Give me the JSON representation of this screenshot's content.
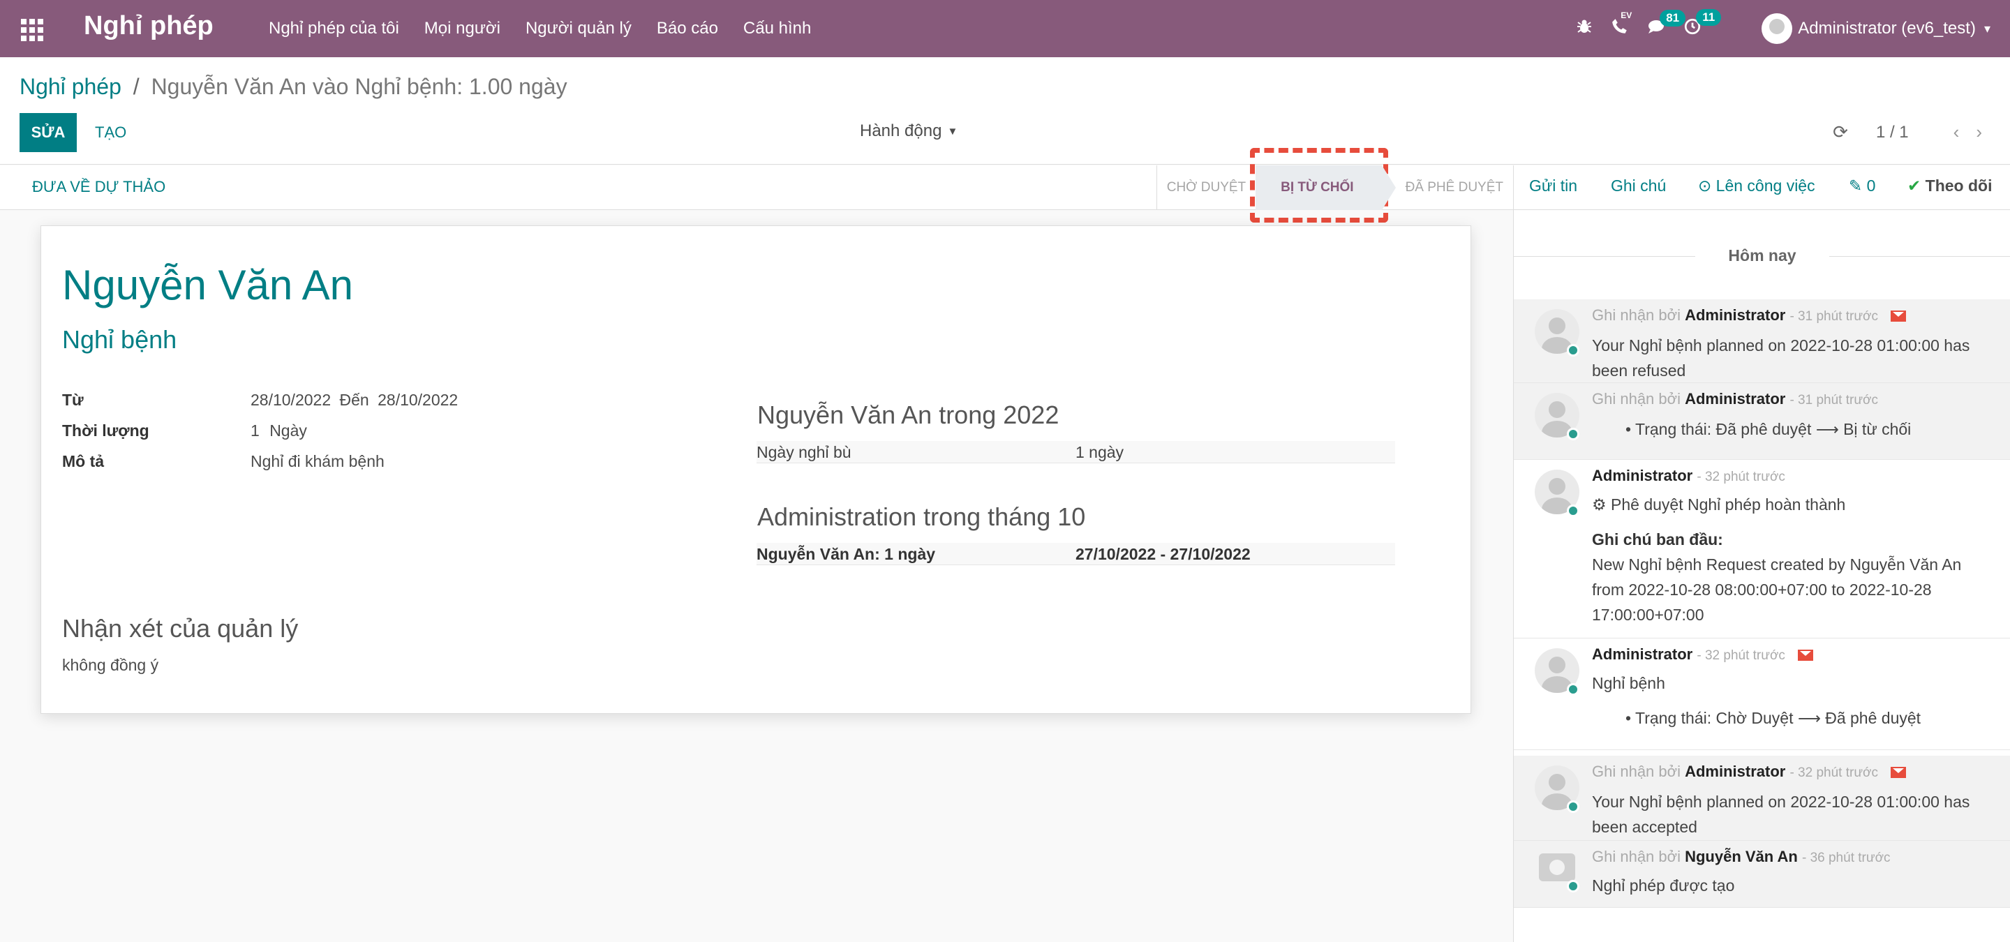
{
  "navbar": {
    "brand": "Nghỉ phép",
    "menu": [
      "Nghỉ phép của tôi",
      "Mọi người",
      "Người quản lý",
      "Báo cáo",
      "Cấu hình"
    ],
    "ev_label": "EV",
    "messages_count": "81",
    "activities_count": "11",
    "user": "Administrator (ev6_test)",
    "accent_color": "#875a7b"
  },
  "breadcrumb": {
    "parent": "Nghỉ phép",
    "separator": "/",
    "current": "Nguyễn Văn An vào Nghỉ bệnh: 1.00 ngày"
  },
  "buttons": {
    "edit": "SỬA",
    "create": "TẠO",
    "action": "Hành động"
  },
  "pager": {
    "value": "1 / 1"
  },
  "statusbar": {
    "reset": "ĐƯA VỀ DỰ THẢO",
    "stages": [
      "CHỜ DUYỆT",
      "BỊ TỪ CHỐI",
      "ĐÃ PHÊ DUYỆT"
    ],
    "active_stage": "BỊ TỪ CHỐI"
  },
  "form": {
    "employee": "Nguyễn Văn An",
    "leave_type": "Nghỉ bệnh",
    "from_label": "Từ",
    "from_date": "28/10/2022",
    "to_label": "Đến",
    "to_date": "28/10/2022",
    "duration_label": "Thời lượng",
    "duration_value": "1",
    "duration_unit": "Ngày",
    "desc_label": "Mô tả",
    "desc_value": "Nghỉ đi khám bệnh",
    "summary_title": "Nguyễn Văn An trong 2022",
    "summary_row_label": "Ngày nghỉ bù",
    "summary_row_value": "1 ngày",
    "month_title": "Administration trong tháng 10",
    "month_row_label": "Nguyễn Văn An: 1 ngày",
    "month_row_value": "27/10/2022 - 27/10/2022",
    "manager_title": "Nhận xét của quản lý",
    "manager_comment": "không đồng ý"
  },
  "chatter": {
    "send": "Gửi tin",
    "note": "Ghi chú",
    "activity": "Lên công việc",
    "attachments": "0",
    "follow": "Theo dõi",
    "today": "Hôm nay",
    "messages": [
      {
        "prefix": "Ghi nhận bởi",
        "author": "Administrator",
        "ago": "- 31 phút trước",
        "lines": [
          "Your Nghỉ bệnh planned on 2022-10-28 01:00:00 has",
          "been refused"
        ]
      },
      {
        "prefix": "Ghi nhận bởi",
        "author": "Administrator",
        "ago": "- 31 phút trước",
        "lines": [
          "•  Trạng thái: Đã phê duyệt ⟶ Bị từ chối"
        ]
      },
      {
        "prefix": "",
        "author": "Administrator",
        "ago": "- 32 phút trước",
        "lines": [
          "Phê duyệt Nghỉ phép hoàn thành",
          "Ghi chú ban đầu:",
          "New Nghỉ bệnh Request created by Nguyễn Văn An",
          "from 2022-10-28 08:00:00+07:00 to 2022-10-28",
          "17:00:00+07:00"
        ]
      },
      {
        "prefix": "",
        "author": "Administrator",
        "ago": "- 32 phút trước",
        "lines": [
          "Nghỉ bệnh",
          "•  Trạng thái: Chờ Duyệt ⟶ Đã phê duyệt"
        ]
      },
      {
        "prefix": "Ghi nhận bởi",
        "author": "Administrator",
        "ago": "- 32 phút trước",
        "lines": [
          "Your Nghỉ bệnh planned on 2022-10-28 01:00:00 has",
          "been accepted"
        ]
      },
      {
        "prefix": "Ghi nhận bởi",
        "author": "Nguyễn Văn An",
        "ago": "- 36 phút trước",
        "lines": [
          "Nghỉ phép được tạo"
        ]
      }
    ]
  }
}
